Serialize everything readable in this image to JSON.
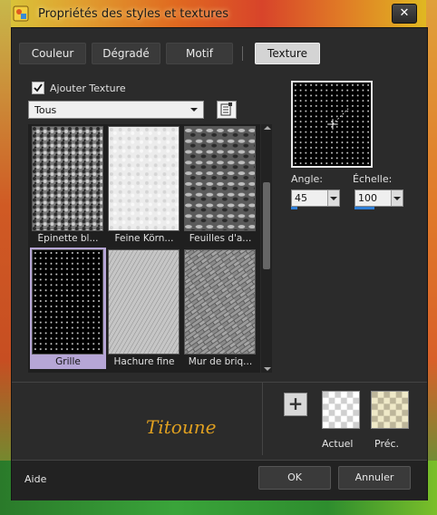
{
  "window": {
    "title": "Propriétés des styles et textures",
    "close_glyph": "✕"
  },
  "tabs": [
    {
      "label": "Couleur",
      "active": false
    },
    {
      "label": "Dégradé",
      "active": false
    },
    {
      "label": "Motif",
      "active": false
    },
    {
      "label": "Texture",
      "active": true
    }
  ],
  "texture": {
    "add_texture_label": "Ajouter Texture",
    "add_texture_checked": true,
    "category_selected": "Tous",
    "items": [
      {
        "label": "Épinette bl...",
        "pattern": "noise-dark"
      },
      {
        "label": "Feine Körn...",
        "pattern": "noise-light"
      },
      {
        "label": "Feuilles d'a...",
        "pattern": "leaves"
      },
      {
        "label": "Grille",
        "pattern": "dots",
        "selected": true
      },
      {
        "label": "Hachure fine",
        "pattern": "hatch"
      },
      {
        "label": "Mur de briq...",
        "pattern": "bricks"
      }
    ]
  },
  "params": {
    "angle_label": "Angle:",
    "angle_value": "45",
    "angle_fraction": 0.125,
    "scale_label": "Échelle:",
    "scale_value": "100",
    "scale_fraction": 0.4
  },
  "signature": "Titoune",
  "swatches": {
    "current_label": "Actuel",
    "previous_label": "Préc."
  },
  "buttons": {
    "help": "Aide",
    "ok": "OK",
    "cancel": "Annuler",
    "plus": "+"
  },
  "icons": {
    "checkbox": "checkmark-icon",
    "browse": "texture-browse-icon",
    "close": "close-icon"
  },
  "colors": {
    "selection": "#b6a6d6",
    "accent": "#2e7fd8",
    "signature": "#e0a020"
  }
}
